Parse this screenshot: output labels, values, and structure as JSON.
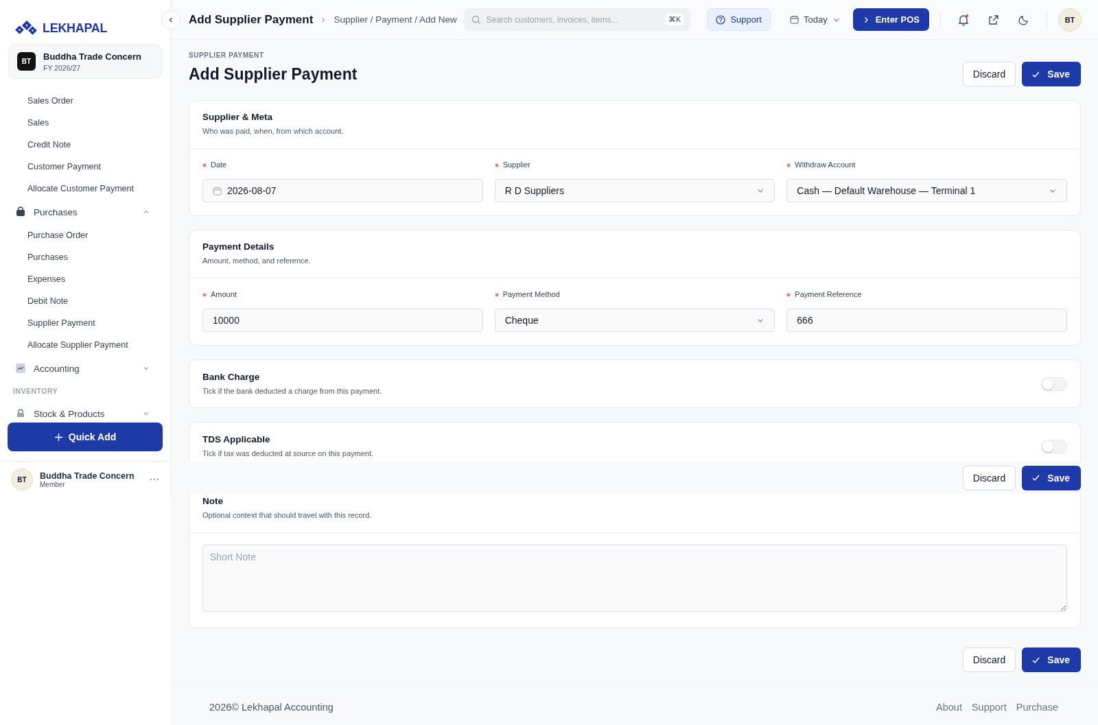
{
  "brand": {
    "name": "LEKHAPAL"
  },
  "org": {
    "initials": "BT",
    "name": "Buddha Trade Concern",
    "period": "FY 2026/27"
  },
  "nav": [
    {
      "kind": "sub",
      "label": "Sales Order"
    },
    {
      "kind": "sub",
      "label": "Sales"
    },
    {
      "kind": "sub",
      "label": "Credit Note"
    },
    {
      "kind": "sub",
      "label": "Customer Payment"
    },
    {
      "kind": "sub",
      "label": "Allocate Customer Payment"
    },
    {
      "kind": "group",
      "label": "Purchases",
      "expanded": true
    },
    {
      "kind": "sub",
      "label": "Purchase Order"
    },
    {
      "kind": "sub",
      "label": "Purchases"
    },
    {
      "kind": "sub",
      "label": "Expenses"
    },
    {
      "kind": "sub",
      "label": "Debit Note"
    },
    {
      "kind": "sub",
      "label": "Supplier Payment"
    },
    {
      "kind": "sub",
      "label": "Allocate Supplier Payment"
    },
    {
      "kind": "group",
      "label": "Accounting",
      "expanded": false
    },
    {
      "kind": "section",
      "label": "INVENTORY"
    },
    {
      "kind": "group",
      "label": "Stock & Products",
      "expanded": false
    }
  ],
  "quick_add": "Quick Add",
  "user": {
    "initials": "BT",
    "name": "Buddha Trade Concern",
    "role": "Member"
  },
  "header": {
    "title": "Add Supplier Payment",
    "breadcrumb": "Supplier / Payment / Add New",
    "search": {
      "placeholder": "Search customers, invoices, items...",
      "shortcut": "⌘K"
    },
    "support": "Support",
    "date_filter": "Today",
    "pos": "Enter POS",
    "notifications_unread": true,
    "avatar": "BT"
  },
  "page": {
    "eyebrow": "SUPPLIER PAYMENT",
    "title": "Add Supplier Payment",
    "discard": "Discard",
    "save": "Save"
  },
  "sections": [
    {
      "kind": "fields",
      "title": "Supplier & Meta",
      "subtitle": "Who was paid, when, from which account.",
      "fields": [
        {
          "kind": "date",
          "label": "Date",
          "required": true,
          "value": "2026-08-07"
        },
        {
          "kind": "select",
          "label": "Supplier",
          "required": true,
          "value": "R D Suppliers"
        },
        {
          "kind": "select",
          "label": "Withdraw Account",
          "required": true,
          "value": "Cash — Default Warehouse — Terminal 1"
        }
      ]
    },
    {
      "kind": "fields",
      "title": "Payment Details",
      "subtitle": "Amount, method, and reference.",
      "fields": [
        {
          "kind": "text",
          "label": "Amount",
          "required": true,
          "value": "10000"
        },
        {
          "kind": "select",
          "label": "Payment Method",
          "required": true,
          "value": "Cheque"
        },
        {
          "kind": "text",
          "label": "Payment Reference",
          "required": true,
          "value": "666"
        }
      ]
    },
    {
      "kind": "toggle",
      "title": "Bank Charge",
      "subtitle": "Tick if the bank deducted a charge from this payment.",
      "on": false
    },
    {
      "kind": "toggle",
      "title": "TDS Applicable",
      "subtitle": "Tick if tax was deducted at source on this payment.",
      "on": false
    },
    {
      "kind": "note",
      "title": "Note",
      "subtitle": "Optional context that should travel with this record.",
      "placeholder": "Short Note"
    }
  ],
  "sticky_bar": {
    "discard": "Discard",
    "save": "Save"
  },
  "bottom_actions": {
    "discard": "Discard",
    "save": "Save"
  },
  "footer": {
    "copyright": "2026© Lekhapal Accounting",
    "links": [
      "About",
      "Support",
      "Purchase"
    ]
  }
}
